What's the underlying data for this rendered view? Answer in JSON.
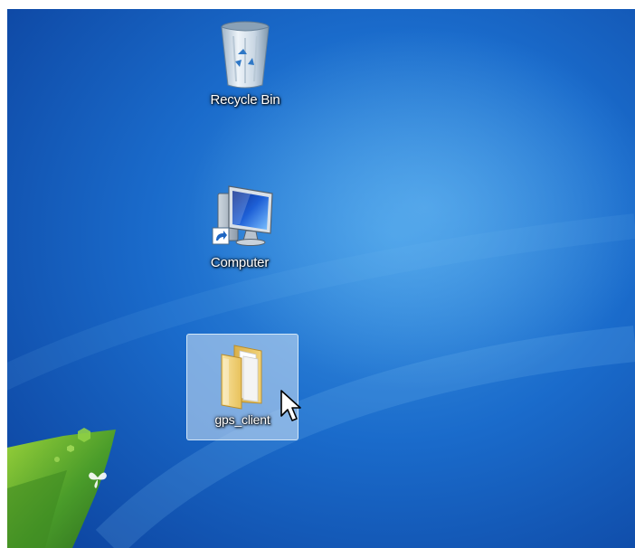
{
  "desktop": {
    "icons": [
      {
        "label": "Recycle Bin",
        "icon": "recycle-bin-icon",
        "selected": false
      },
      {
        "label": "Computer",
        "icon": "computer-shortcut-icon",
        "selected": false
      },
      {
        "label": "gps_client",
        "icon": "folder-icon",
        "selected": true
      }
    ]
  },
  "colors": {
    "wallpaper_light": "#4aa3e6",
    "wallpaper_mid": "#1a67c7",
    "wallpaper_dark": "#0a3d99",
    "accent_green": "#5aa832",
    "selection": "#bed7f0"
  }
}
